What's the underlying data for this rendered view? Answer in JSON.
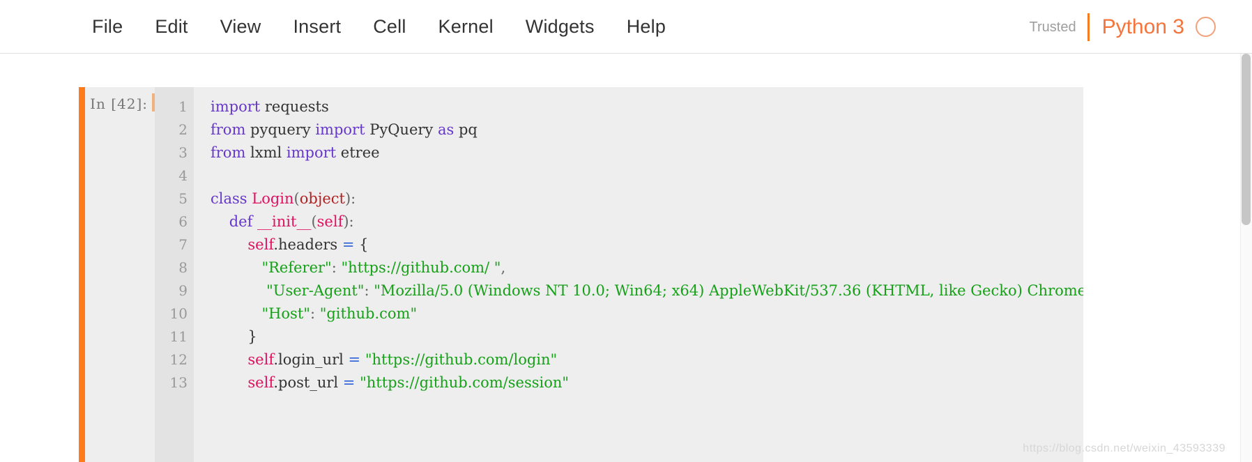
{
  "menubar": {
    "items": [
      {
        "label": "File"
      },
      {
        "label": "Edit"
      },
      {
        "label": "View"
      },
      {
        "label": "Insert"
      },
      {
        "label": "Cell"
      },
      {
        "label": "Kernel"
      },
      {
        "label": "Widgets"
      },
      {
        "label": "Help"
      }
    ],
    "trusted_label": "Trusted",
    "kernel_name": "Python 3",
    "kernel_indicator": "kernel-idle-circle"
  },
  "colors": {
    "accent_orange": "#ff7a18",
    "kernel_orange": "#f4743b",
    "cell_background": "#eeeeee",
    "gutter_background": "#e3e3e3",
    "keyword": "#6638c9",
    "class_name": "#e0115f",
    "builtin": "#b22222",
    "string": "#16a018",
    "operator": "#2b5fd9",
    "text": "#303030"
  },
  "cell": {
    "prompt": "In  [42]:",
    "line_numbers": [
      "1",
      "2",
      "3",
      "4",
      "5",
      "6",
      "7",
      "8",
      "9",
      "10",
      "11",
      "12",
      "13"
    ],
    "lines": [
      [
        {
          "t": "kw",
          "s": "import"
        },
        {
          "t": "txt",
          "s": " requests"
        }
      ],
      [
        {
          "t": "kw",
          "s": "from"
        },
        {
          "t": "txt",
          "s": " pyquery "
        },
        {
          "t": "kw",
          "s": "import"
        },
        {
          "t": "txt",
          "s": " PyQuery "
        },
        {
          "t": "kw",
          "s": "as"
        },
        {
          "t": "txt",
          "s": " pq"
        }
      ],
      [
        {
          "t": "kw",
          "s": "from"
        },
        {
          "t": "txt",
          "s": " lxml "
        },
        {
          "t": "kw",
          "s": "import"
        },
        {
          "t": "txt",
          "s": " etree"
        }
      ],
      [],
      [
        {
          "t": "kw",
          "s": "class"
        },
        {
          "t": "txt",
          "s": " "
        },
        {
          "t": "cls",
          "s": "Login"
        },
        {
          "t": "pun",
          "s": "("
        },
        {
          "t": "bi",
          "s": "object"
        },
        {
          "t": "pun",
          "s": "):"
        }
      ],
      [
        {
          "t": "txt",
          "s": "    "
        },
        {
          "t": "kw",
          "s": "def"
        },
        {
          "t": "txt",
          "s": " "
        },
        {
          "t": "cls",
          "s": "__init__"
        },
        {
          "t": "pun",
          "s": "("
        },
        {
          "t": "self",
          "s": "self"
        },
        {
          "t": "pun",
          "s": "):"
        }
      ],
      [
        {
          "t": "txt",
          "s": "        "
        },
        {
          "t": "self",
          "s": "self"
        },
        {
          "t": "txt",
          "s": ".headers "
        },
        {
          "t": "op",
          "s": "="
        },
        {
          "t": "txt",
          "s": " {"
        }
      ],
      [
        {
          "t": "txt",
          "s": "           "
        },
        {
          "t": "str",
          "s": "\"Referer\""
        },
        {
          "t": "pun",
          "s": ":"
        },
        {
          "t": "txt",
          "s": " "
        },
        {
          "t": "str",
          "s": "\"https://github.com/ \""
        },
        {
          "t": "pun",
          "s": ","
        }
      ],
      [
        {
          "t": "txt",
          "s": "            "
        },
        {
          "t": "str",
          "s": "\"User-Agent\""
        },
        {
          "t": "pun",
          "s": ":"
        },
        {
          "t": "txt",
          "s": " "
        },
        {
          "t": "str",
          "s": "\"Mozilla/5.0 (Windows NT 10.0; Win64; x64) AppleWebKit/537.36 (KHTML, like Gecko) Chrome"
        }
      ],
      [
        {
          "t": "txt",
          "s": "           "
        },
        {
          "t": "str",
          "s": "\"Host\""
        },
        {
          "t": "pun",
          "s": ":"
        },
        {
          "t": "txt",
          "s": " "
        },
        {
          "t": "str",
          "s": "\"github.com\""
        }
      ],
      [
        {
          "t": "txt",
          "s": "        }"
        }
      ],
      [
        {
          "t": "txt",
          "s": "        "
        },
        {
          "t": "self",
          "s": "self"
        },
        {
          "t": "txt",
          "s": ".login_url "
        },
        {
          "t": "op",
          "s": "="
        },
        {
          "t": "txt",
          "s": " "
        },
        {
          "t": "str",
          "s": "\"https://github.com/login\""
        }
      ],
      [
        {
          "t": "txt",
          "s": "        "
        },
        {
          "t": "self",
          "s": "self"
        },
        {
          "t": "txt",
          "s": ".post_url "
        },
        {
          "t": "op",
          "s": "="
        },
        {
          "t": "txt",
          "s": " "
        },
        {
          "t": "str",
          "s": "\"https://github.com/session\""
        }
      ]
    ]
  },
  "watermark": {
    "text": "https://blog.csdn.net/weixin_43593339"
  }
}
